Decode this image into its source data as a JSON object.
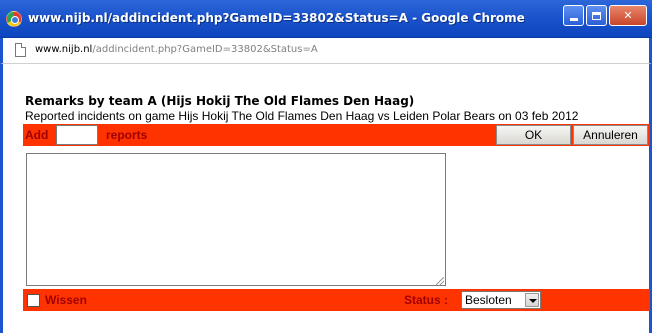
{
  "window": {
    "title": "www.nijb.nl/addincident.php?GameID=33802&Status=A - Google Chrome",
    "accent": "#1b54cc"
  },
  "addressbar": {
    "host": "www.nijb.nl",
    "path": "/addincident.php?GameID=33802&Status=A"
  },
  "page": {
    "heading": "Remarks by team A (Hijs Hokij The Old Flames Den Haag)",
    "subtitle": "Reported incidents on game Hijs Hokij The Old Flames Den Haag vs Leiden Polar Bears on 03 feb 2012"
  },
  "toolbar": {
    "add_label": "Add",
    "count_value": "",
    "reports_label": "reports",
    "ok_label": "OK",
    "cancel_label": "Annuleren",
    "bar_color": "#ff3300",
    "label_color": "#a00000"
  },
  "remarks": {
    "value": ""
  },
  "footer": {
    "wissen_label": "Wissen",
    "wissen_checked": false,
    "status_label": "Status :",
    "status_value": "Besloten"
  }
}
